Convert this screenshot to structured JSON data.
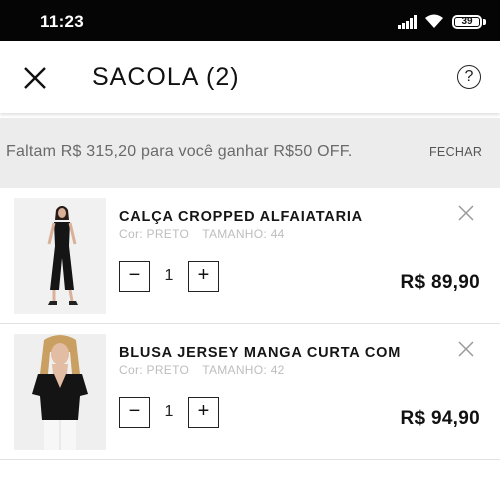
{
  "status_bar": {
    "time": "11:23",
    "battery": "39",
    "icons": [
      "signal-icon",
      "wifi-icon",
      "battery-icon"
    ]
  },
  "header": {
    "title": "SACOLA (2)",
    "close_icon": "close-icon",
    "help_label": "?"
  },
  "promo": {
    "message": "Faltam R$ 315,20 para você ganhar R$50 OFF.",
    "dismiss_label": "FECHAR",
    "background": "#ececec"
  },
  "cart": {
    "items": [
      {
        "name": "CALÇA CROPPED ALFAIATARIA",
        "color_label": "Cor:",
        "color_value": "PRETO",
        "size_label": "TAMANHO:",
        "size_value": "44",
        "quantity": "1",
        "price": "R$ 89,90",
        "decrement_label": "−",
        "increment_label": "+"
      },
      {
        "name": "BLUSA JERSEY MANGA CURTA COM",
        "color_label": "Cor:",
        "color_value": "PRETO",
        "size_label": "TAMANHO:",
        "size_value": "42",
        "quantity": "1",
        "price": "R$ 94,90",
        "decrement_label": "−",
        "increment_label": "+"
      }
    ]
  }
}
